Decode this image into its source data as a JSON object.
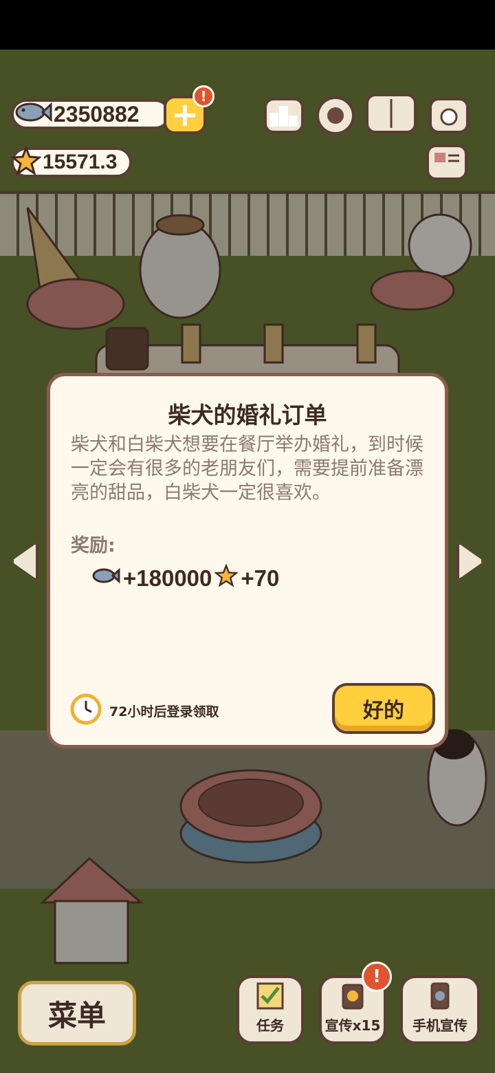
{
  "currency": {
    "fish_amount": "2350882",
    "star_amount": "15571.3",
    "fish_icon": "fish-icon",
    "star_icon": "star-icon"
  },
  "dialog": {
    "title": "柴犬的婚礼订单",
    "description": "柴犬和白柴犬想要在餐厅举办婚礼，到时候一定会有很多的老朋友们，需要提前准备漂亮的甜品，白柴犬一定很喜欢。",
    "reward_label": "奖励:",
    "reward_fish": "+180000",
    "reward_stars": "+70",
    "timer_text": "72小时后登录领取",
    "ok_button": "好的"
  },
  "bottom_bar": {
    "menu": "菜单",
    "tasks": "任务",
    "promote": "宣传x15",
    "phone_promote": "手机宣传"
  },
  "colors": {
    "accent_yellow": "#ffcf3e",
    "outline_brown": "#5a3e34",
    "panel_cream": "#fff8ec",
    "alert_red": "#e0532e"
  }
}
